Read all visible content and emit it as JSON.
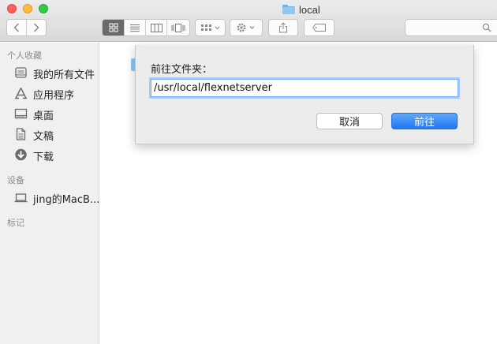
{
  "window": {
    "title": "local"
  },
  "toolbar": {
    "icons": [
      "back-icon",
      "forward-icon",
      "icon-view-icon",
      "list-view-icon",
      "column-view-icon",
      "cover-flow-icon",
      "group-icon",
      "gear-icon",
      "share-icon",
      "tag-icon",
      "search-icon"
    ]
  },
  "sidebar": {
    "sections": [
      {
        "label": "个人收藏"
      },
      {
        "label": "设备"
      },
      {
        "label": "标记"
      }
    ],
    "favorites": [
      {
        "label": "我的所有文件",
        "icon": "all-files-icon"
      },
      {
        "label": "应用程序",
        "icon": "applications-icon"
      },
      {
        "label": "桌面",
        "icon": "desktop-icon"
      },
      {
        "label": "文稿",
        "icon": "documents-icon"
      },
      {
        "label": "下载",
        "icon": "downloads-icon"
      }
    ],
    "devices": [
      {
        "label": "jing的MacB...",
        "icon": "laptop-icon"
      }
    ]
  },
  "dialog": {
    "label": "前往文件夹：",
    "path_value": "/usr/local/flexnetserver",
    "cancel_label": "取消",
    "go_label": "前往"
  },
  "colors": {
    "accent": "#2176f2",
    "focus_ring": "#a9ccf6"
  }
}
